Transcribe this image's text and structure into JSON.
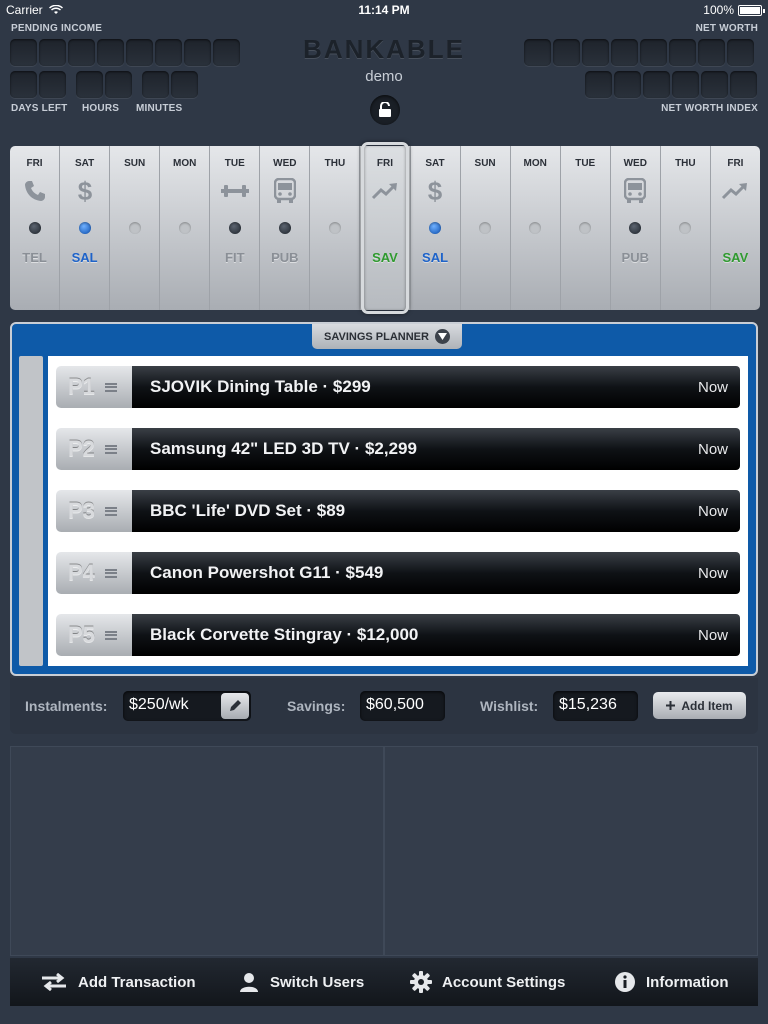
{
  "status": {
    "carrier": "Carrier",
    "time": "11:14 PM",
    "battery": "100%"
  },
  "header": {
    "pending_income_label": "PENDING INCOME",
    "net_worth_label": "NET WORTH",
    "days_left_label": "DAYS LEFT",
    "hours_label": "HOURS",
    "minutes_label": "MINUTES",
    "net_worth_index_label": "NET WORTH INDEX",
    "app_title": "BANKABLE",
    "user": "demo"
  },
  "calendar": [
    {
      "day": "FRI",
      "icon": "phone-icon",
      "dot": "dark",
      "code": "TEL",
      "code_color": "gray"
    },
    {
      "day": "SAT",
      "icon": "dollar-icon",
      "dot": "blue",
      "code": "SAL",
      "code_color": "blue"
    },
    {
      "day": "SUN",
      "icon": "",
      "dot": "light",
      "code": "",
      "code_color": "gray"
    },
    {
      "day": "MON",
      "icon": "",
      "dot": "light",
      "code": "",
      "code_color": "gray"
    },
    {
      "day": "TUE",
      "icon": "dumbbell-icon",
      "dot": "dark",
      "code": "FIT",
      "code_color": "gray"
    },
    {
      "day": "WED",
      "icon": "bus-icon",
      "dot": "dark",
      "code": "PUB",
      "code_color": "gray"
    },
    {
      "day": "THU",
      "icon": "",
      "dot": "light",
      "code": "",
      "code_color": "gray"
    },
    {
      "day": "FRI",
      "icon": "trend-up-icon",
      "dot": "none",
      "code": "SAV",
      "code_color": "green",
      "selected": true
    },
    {
      "day": "SAT",
      "icon": "dollar-icon",
      "dot": "blue",
      "code": "SAL",
      "code_color": "blue"
    },
    {
      "day": "SUN",
      "icon": "",
      "dot": "light",
      "code": "",
      "code_color": "gray"
    },
    {
      "day": "MON",
      "icon": "",
      "dot": "light",
      "code": "",
      "code_color": "gray"
    },
    {
      "day": "TUE",
      "icon": "",
      "dot": "light",
      "code": "",
      "code_color": "gray"
    },
    {
      "day": "WED",
      "icon": "bus-icon",
      "dot": "dark",
      "code": "PUB",
      "code_color": "gray"
    },
    {
      "day": "THU",
      "icon": "",
      "dot": "light",
      "code": "",
      "code_color": "gray"
    },
    {
      "day": "FRI",
      "icon": "trend-up-icon",
      "dot": "none",
      "code": "SAV",
      "code_color": "green"
    }
  ],
  "planner": {
    "tab_label": "SAVINGS PLANNER",
    "items": [
      {
        "priority": "P1",
        "title": "SJOVIK Dining Table · $299",
        "when": "Now"
      },
      {
        "priority": "P2",
        "title": "Samsung 42\" LED 3D TV · $2,299",
        "when": "Now"
      },
      {
        "priority": "P3",
        "title": "BBC 'Life' DVD Set · $89",
        "when": "Now"
      },
      {
        "priority": "P4",
        "title": "Canon Powershot G11 · $549",
        "when": "Now"
      },
      {
        "priority": "P5",
        "title": "Black Corvette Stingray · $12,000",
        "when": "Now"
      }
    ]
  },
  "summary": {
    "instalments_label": "Instalments:",
    "instalments_value": "$250/wk",
    "savings_label": "Savings:",
    "savings_value": "$60,500",
    "wishlist_label": "Wishlist:",
    "wishlist_value": "$15,236",
    "add_item_label": "Add Item"
  },
  "toolbar": {
    "add_transaction": "Add Transaction",
    "switch_users": "Switch Users",
    "account_settings": "Account Settings",
    "information": "Information"
  },
  "colors": {
    "planner_blue": "#0e5aa8",
    "sal_blue": "#1e63c9",
    "sav_green": "#2f9a2f"
  }
}
